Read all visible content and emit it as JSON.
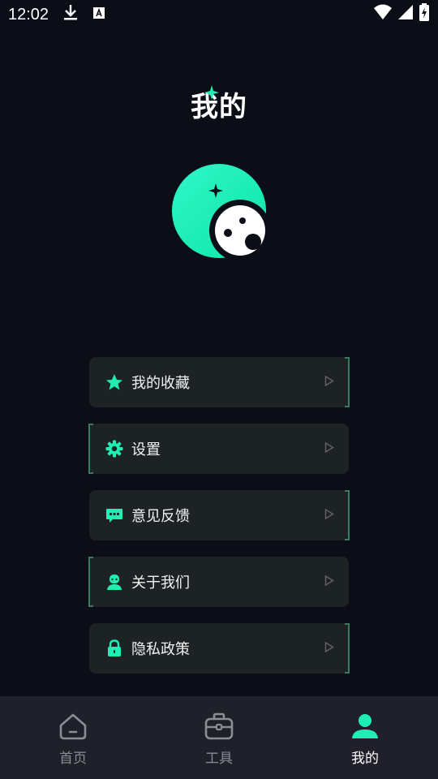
{
  "status_bar": {
    "time": "12:02"
  },
  "page": {
    "title": "我的"
  },
  "menu": [
    {
      "label": "我的收藏",
      "icon": "star-icon",
      "bracket": "right"
    },
    {
      "label": "设置",
      "icon": "gear-icon",
      "bracket": "left"
    },
    {
      "label": "意见反馈",
      "icon": "chat-icon",
      "bracket": "right"
    },
    {
      "label": "关于我们",
      "icon": "person-icon",
      "bracket": "left"
    },
    {
      "label": "隐私政策",
      "icon": "lock-icon",
      "bracket": "right"
    }
  ],
  "tabs": [
    {
      "label": "首页",
      "icon": "home-icon",
      "active": false
    },
    {
      "label": "工具",
      "icon": "toolbox-icon",
      "active": false
    },
    {
      "label": "我的",
      "icon": "user-icon",
      "active": true
    }
  ],
  "colors": {
    "accent": "#1ef0b4",
    "background": "#0b0e16",
    "card": "#1d2225",
    "tabbar": "#1f2029"
  }
}
